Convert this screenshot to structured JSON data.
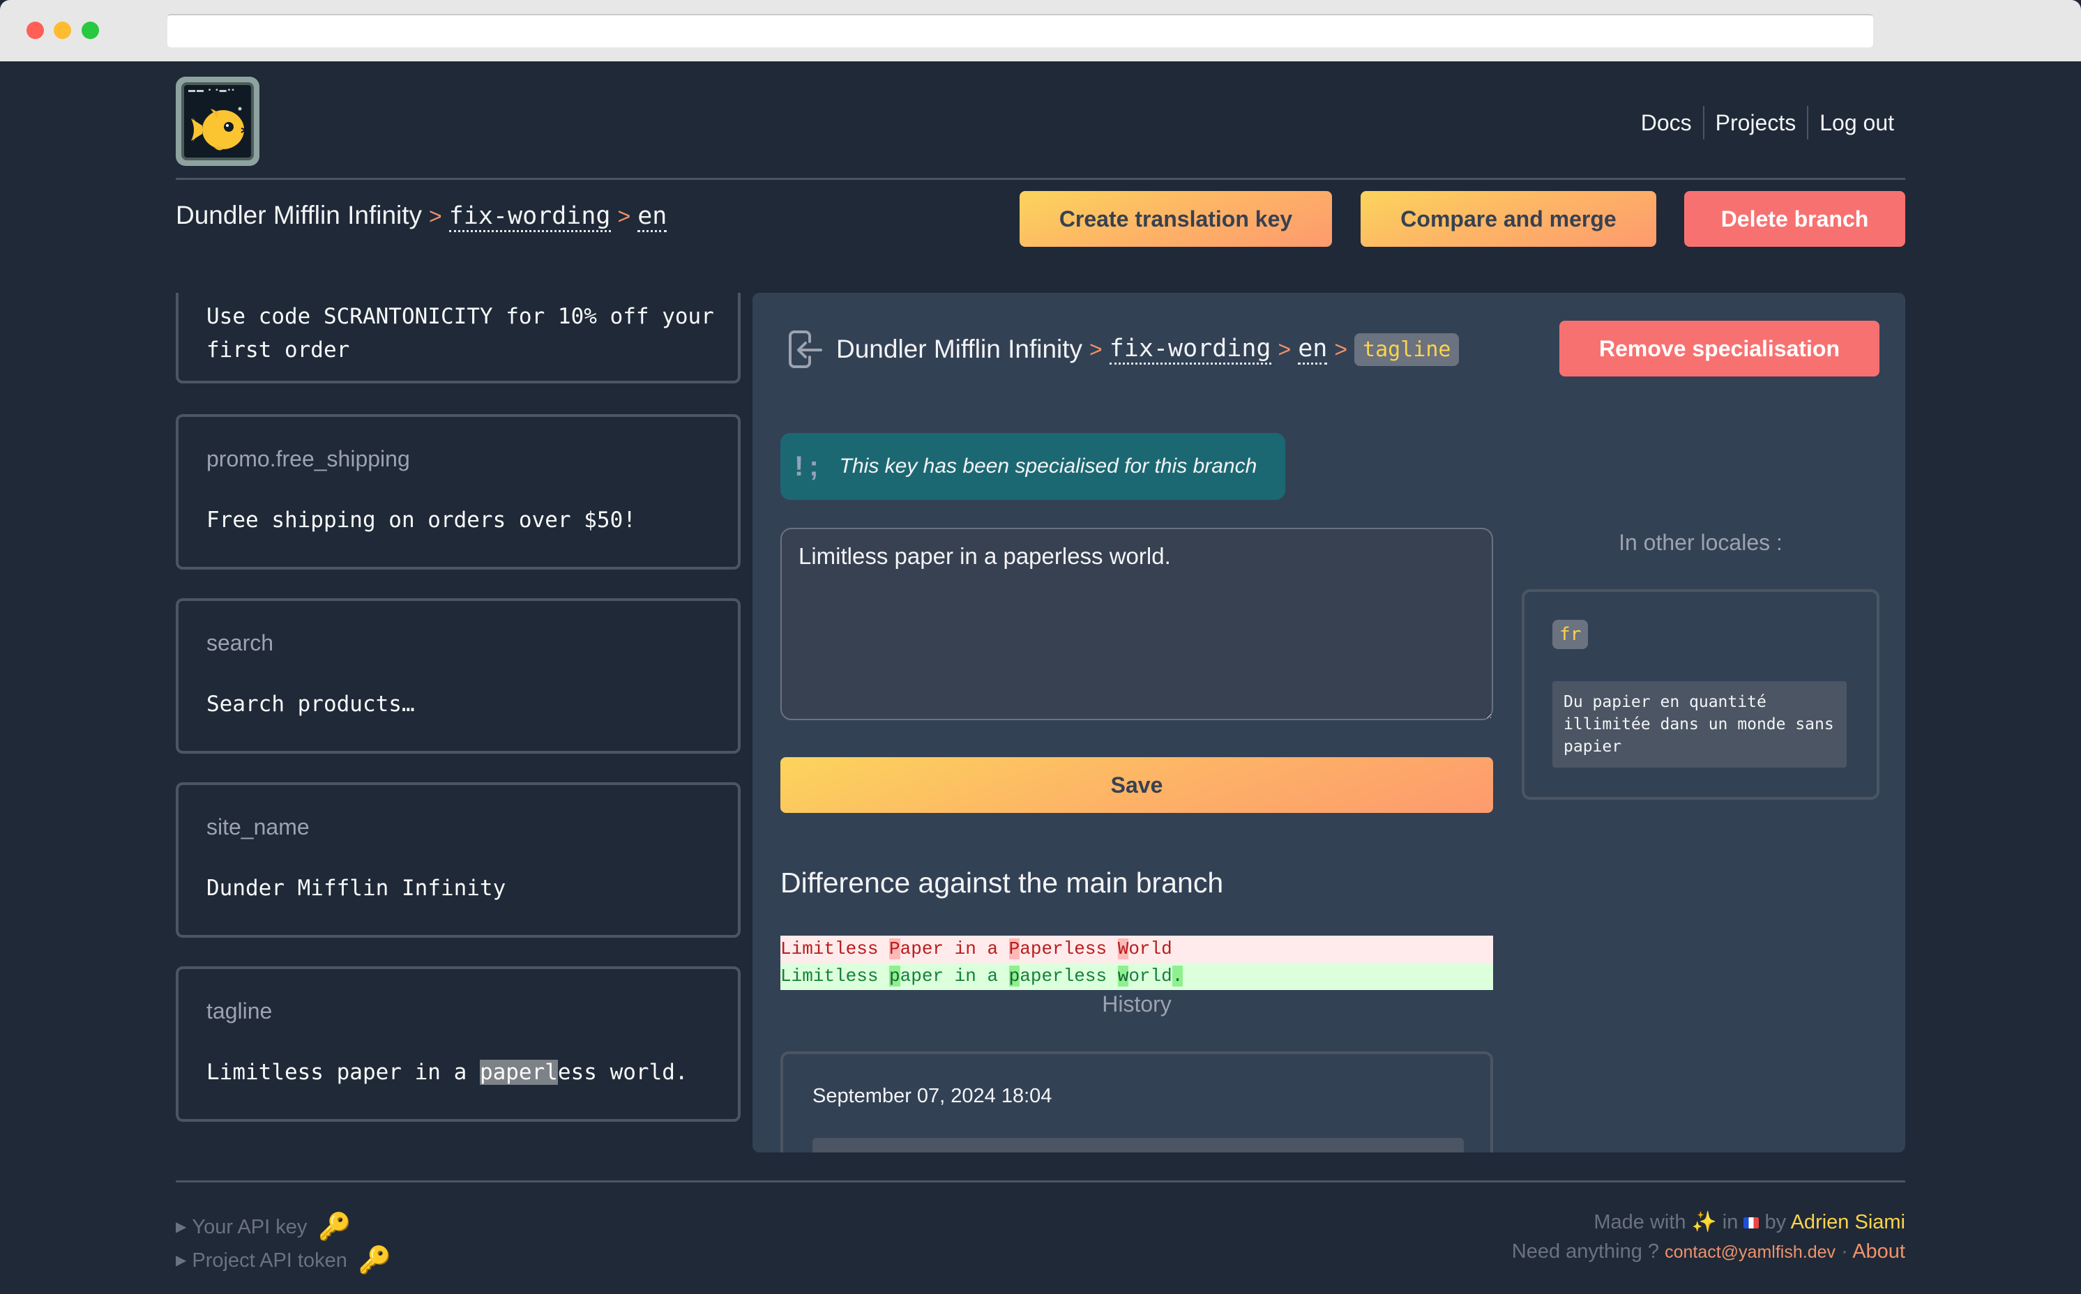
{
  "browser": {
    "url": ""
  },
  "header": {
    "logo_alt": "yamlfish logo",
    "nav": [
      {
        "label": "Docs"
      },
      {
        "label": "Projects"
      },
      {
        "label": "Log out"
      }
    ]
  },
  "breadcrumb": {
    "project": "Dundler Mifflin Infinity",
    "separator": ">",
    "branch": "fix-wording",
    "locale": "en"
  },
  "toolbar": {
    "create_key": "Create translation key",
    "compare_merge": "Compare and merge",
    "delete_branch": "Delete branch"
  },
  "keys": [
    {
      "name": "",
      "value": "Use code SCRANTONICITY for 10% off your first order"
    },
    {
      "name": "promo.free_shipping",
      "value": "Free shipping on orders over $50!"
    },
    {
      "name": "search",
      "value": "Search products…"
    },
    {
      "name": "site_name",
      "value": "Dunder Mifflin Infinity"
    },
    {
      "name": "tagline",
      "value_before": "Limitless paper in a ",
      "value_highlight": "paperl",
      "value_after": "ess world."
    }
  ],
  "panel": {
    "breadcrumb": {
      "project": "Dundler Mifflin Infinity",
      "branch": "fix-wording",
      "locale": "en",
      "key": "tagline"
    },
    "remove_specialisation": "Remove specialisation",
    "notice_icon": "!;",
    "notice": "This key has been specialised for this branch",
    "translation_value": "Limitless paper in a paperless world.",
    "save": "Save",
    "diff_title": "Difference against the main branch",
    "diff": {
      "removed": [
        "Limitless ",
        "P",
        "aper in a ",
        "P",
        "aperless ",
        "W",
        "orld"
      ],
      "added": [
        "Limitless ",
        "p",
        "aper in a ",
        "p",
        "aperless ",
        "w",
        "orld",
        "."
      ]
    },
    "history_title": "History",
    "history": [
      {
        "date": "September 07, 2024 18:04"
      }
    ],
    "other_locales_title": "In other locales :",
    "other_locales": [
      {
        "locale": "fr",
        "value": "Du papier en quantité illimitée dans un monde sans papier"
      }
    ]
  },
  "footer": {
    "api_key": "Your API key",
    "project_token": "Project API token",
    "made_with_prefix": "Made with",
    "made_with_in": "in",
    "made_with_by": "by",
    "author": "Adrien Siami",
    "need_anything": "Need anything ?",
    "contact": "contact@yamlfish.dev",
    "dot": "·",
    "about": "About"
  },
  "colors": {
    "background": "#1f2937",
    "panel": "#334155",
    "accent_orange": "#f0926b",
    "accent_yellow": "#fcd34d",
    "danger": "#f87171",
    "notice": "#1c6872"
  }
}
